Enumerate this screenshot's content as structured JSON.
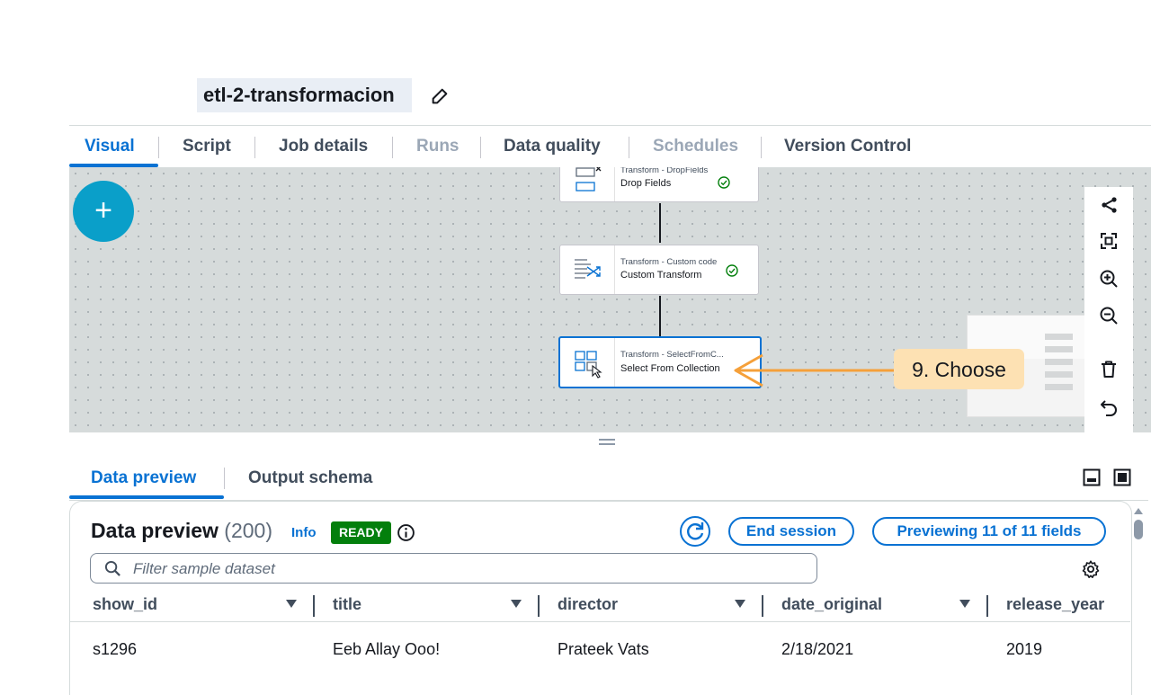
{
  "job": {
    "title": "etl-2-transformacion"
  },
  "tabs": [
    {
      "label": "Visual",
      "state": "active"
    },
    {
      "label": "Script",
      "state": "normal"
    },
    {
      "label": "Job details",
      "state": "normal"
    },
    {
      "label": "Runs",
      "state": "disabled"
    },
    {
      "label": "Data quality",
      "state": "normal"
    },
    {
      "label": "Schedules",
      "state": "disabled"
    },
    {
      "label": "Version Control",
      "state": "normal"
    }
  ],
  "canvas": {
    "add_label": "+",
    "nodes": [
      {
        "type": "Transform - DropFields",
        "name": "Drop Fields",
        "status": "check-icon"
      },
      {
        "type": "Transform - Custom code",
        "name": "Custom Transform",
        "status": "check-icon"
      },
      {
        "type": "Transform - SelectFromC...",
        "name": "Select From Collection",
        "status": "none"
      }
    ],
    "tools": [
      "layout-icon",
      "fit-view-icon",
      "zoom-in-icon",
      "zoom-out-icon",
      "delete-icon",
      "undo-icon"
    ]
  },
  "callout": {
    "label": "9. Choose",
    "color": "#fde1b3",
    "arrow_color": "#f5a03a"
  },
  "bottom_tabs": [
    {
      "label": "Data preview",
      "state": "active"
    },
    {
      "label": "Output schema",
      "state": "normal"
    }
  ],
  "preview": {
    "title": "Data preview",
    "count": "(200)",
    "info": "Info",
    "status": "READY",
    "end_session": "End session",
    "previewing": "Previewing 11 of 11 fields",
    "filter_placeholder": "Filter sample dataset",
    "columns": [
      "show_id",
      "title",
      "director",
      "date_original",
      "release_year"
    ],
    "rows": [
      [
        "s1296",
        "Eeb Allay Ooo!",
        "Prateek Vats",
        "2/18/2021",
        "2019"
      ]
    ]
  },
  "colors": {
    "accent": "#0972d3",
    "ready": "#037f0c",
    "add_button": "#0a9fc9"
  }
}
